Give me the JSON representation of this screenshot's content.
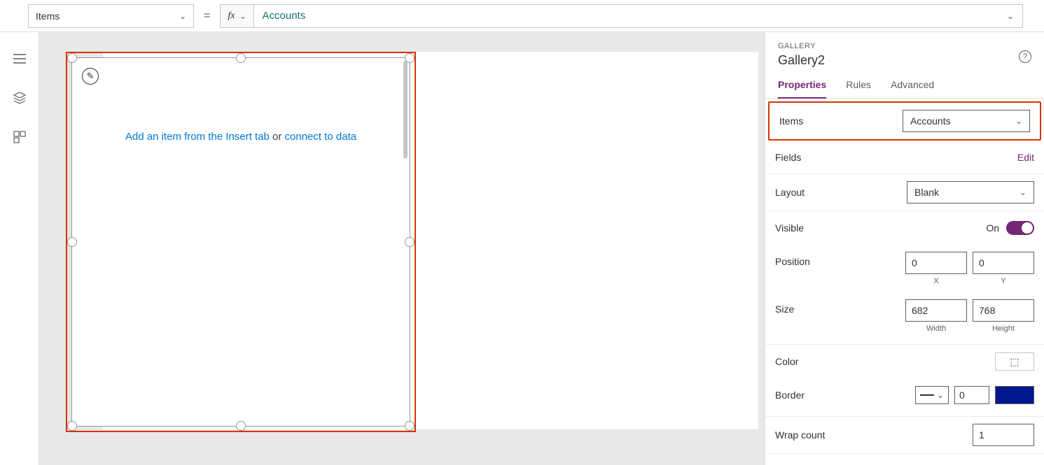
{
  "formulaBar": {
    "property": "Items",
    "fxLabel": "fx",
    "value": "Accounts"
  },
  "gallery": {
    "linkInsert": "Add an item from the Insert tab",
    "or": " or ",
    "linkConnect": "connect to data"
  },
  "panel": {
    "type": "GALLERY",
    "name": "Gallery2",
    "tabs": {
      "properties": "Properties",
      "rules": "Rules",
      "advanced": "Advanced"
    },
    "items": {
      "label": "Items",
      "value": "Accounts"
    },
    "fields": {
      "label": "Fields",
      "action": "Edit"
    },
    "layout": {
      "label": "Layout",
      "value": "Blank"
    },
    "visible": {
      "label": "Visible",
      "state": "On"
    },
    "position": {
      "label": "Position",
      "x": "0",
      "y": "0",
      "xLabel": "X",
      "yLabel": "Y"
    },
    "size": {
      "label": "Size",
      "w": "682",
      "h": "768",
      "wLabel": "Width",
      "hLabel": "Height"
    },
    "color": {
      "label": "Color"
    },
    "border": {
      "label": "Border",
      "width": "0"
    },
    "wrap": {
      "label": "Wrap count",
      "value": "1"
    }
  }
}
